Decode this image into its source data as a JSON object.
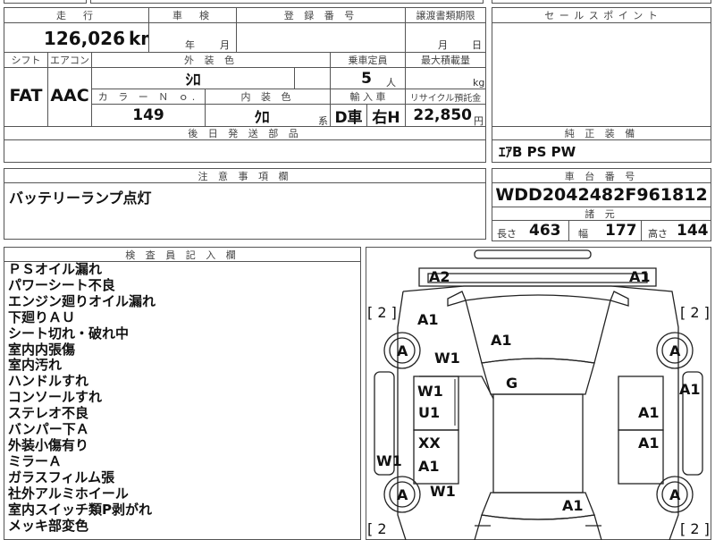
{
  "header": {
    "mileage_label": "走　行",
    "inspection_label": "車　検",
    "registration_label": "登 録 番 号",
    "transfer_label": "譲渡書類期限",
    "sales_point_label": "セ ー ル ス ポ イ ン ト",
    "mileage_value": "126,026",
    "mileage_unit": "km",
    "inspection_year": "年",
    "inspection_month": "月",
    "transfer_month": "月",
    "transfer_day": "日"
  },
  "spec": {
    "shift_label": "シフト",
    "ac_label": "エアコン",
    "exterior_label": "外 装 色",
    "capacity_label": "乗車定員",
    "load_label": "最大積載量",
    "shift_value": "FAT",
    "ac_value": "AAC",
    "exterior_value": "ｼﾛ",
    "capacity_value": "5",
    "capacity_unit": "人",
    "load_unit": "kg",
    "color_no_label": "カ ラ ー Ｎ ｏ.",
    "interior_label": "内 装 色",
    "import_label": "輸 入 車",
    "recycle_label": "リサイクル預託金",
    "color_no_value": "149",
    "interior_value": "ｸﾛ",
    "interior_unit": "系",
    "import_d": "D車",
    "import_h": "右H",
    "recycle_value": "22,850",
    "recycle_unit": "円"
  },
  "later_parts_label": "後 日 発 送 部 品",
  "genuine": {
    "label": "純 正 装 備",
    "value": "ｴｱB PS PW"
  },
  "notes": {
    "label": "注 意 事 項 欄",
    "value": "バッテリーランプ点灯"
  },
  "chassis": {
    "label": "車 台 番 号",
    "value": "WDD2042482F961812",
    "dims_label": "諸 元",
    "length_label": "長さ",
    "length": "463",
    "width_label": "幅",
    "width": "177",
    "height_label": "高さ",
    "height": "144"
  },
  "inspector": {
    "label": "検 査 員 記 入 欄",
    "remarks": [
      "ＰＳオイル漏れ",
      "パワーシート不良",
      "エンジン廻りオイル漏れ",
      "下廻りＡＵ",
      "シート切れ・破れ中",
      "室内内張傷",
      "室内汚れ",
      "ハンドルすれ",
      "コンソールすれ",
      "ステレオ不良",
      "バンパー下Ａ",
      "外装小傷有り",
      "ミラーＡ",
      "ガラスフィルム張",
      "社外アルミホイール",
      "室内スイッチ類P剥がれ",
      "メッキ部変色"
    ]
  },
  "diagram": {
    "bracket_tl": "[ 2 ]",
    "bracket_tr": "[ 2 ]",
    "bracket_bl": "[ 2",
    "bracket_br": "[ 2 ]",
    "marks": {
      "front_left": "A2",
      "front_right": "A1",
      "fender_front_left": "A1",
      "hood": "A1",
      "wheel_fl": "A",
      "wheel_fr": "A",
      "fender_left_w": "W1",
      "roof": "G",
      "door_fl_w": "W1",
      "door_fl_u": "U1",
      "door_rl_x": "XX",
      "door_rl_a": "A1",
      "right_side": "A1",
      "door_fr": "A1",
      "door_rr": "A1",
      "quarter_left": "W1",
      "wheel_rl": "A",
      "wheel_rr": "A",
      "rear_left_w": "W1",
      "trunk": "A1"
    }
  }
}
